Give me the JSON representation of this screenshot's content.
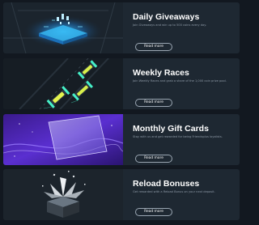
{
  "promotions": [
    {
      "title": "Daily Giveaways",
      "description": "Join Giveaways and win up to 500 coins every day.",
      "button_label": "Read more",
      "image_icon": "giveaway-table-image"
    },
    {
      "title": "Weekly Races",
      "description": "Join Weekly Races and grab a share of the 1,000 coin prize pool.",
      "button_label": "Read more",
      "image_icon": "race-cars-image"
    },
    {
      "title": "Monthly Gift Cards",
      "description": "Stay with us and get rewarded for being Friendsplus loyalists.",
      "button_label": "Read more",
      "image_icon": "gift-card-image"
    },
    {
      "title": "Reload Bonuses",
      "description": "Get rewarded with a Reload Bonus on your next deposit.",
      "button_label": "Read more",
      "image_icon": "gift-box-image"
    }
  ],
  "colors": {
    "page_background": "#121820",
    "card_background": "#1e2832",
    "title_text": "#ffffff",
    "description_text": "#8e9aa7",
    "button_border": "#9aa6b2"
  }
}
